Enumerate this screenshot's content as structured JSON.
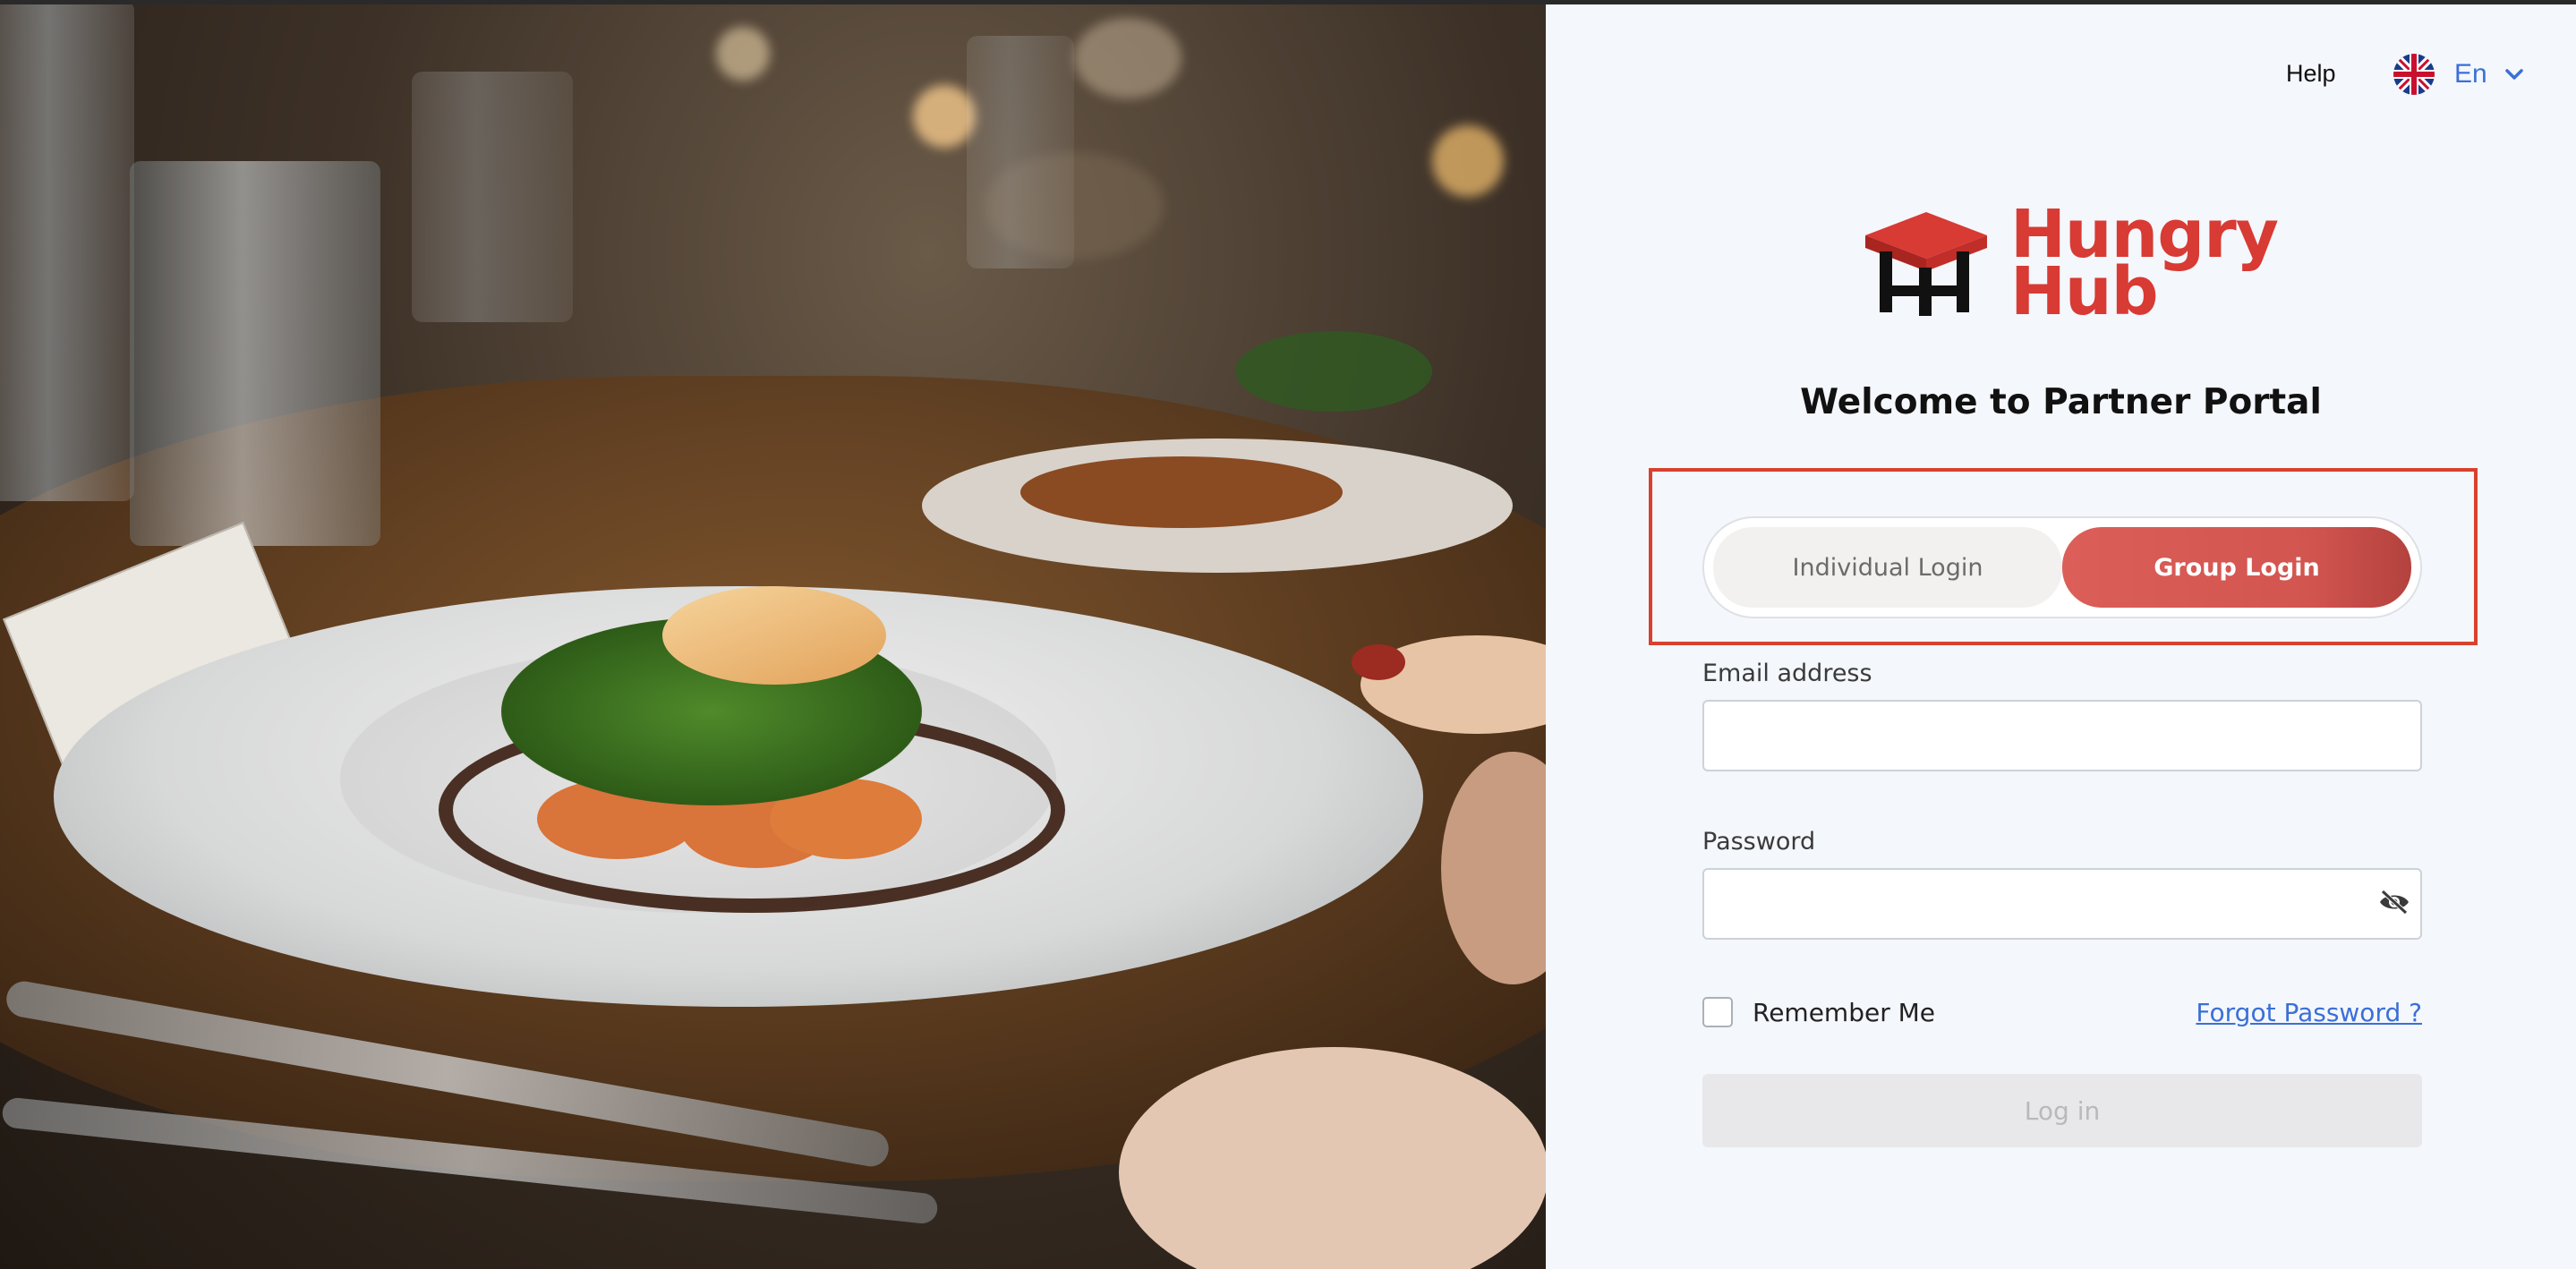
{
  "header": {
    "help_label": "Help",
    "language": {
      "code": "En",
      "flag_icon": "uk-flag-icon",
      "chevron_icon": "chevron-down-icon"
    }
  },
  "brand": {
    "logo_line1": "Hungry",
    "logo_line2": "Hub",
    "logo_icon": "table-icon",
    "color": "#d83a34"
  },
  "welcome_title": "Welcome to Partner Portal",
  "login_tabs": {
    "individual": "Individual Login",
    "group": "Group Login",
    "selected": "group"
  },
  "form": {
    "email_label": "Email address",
    "email_value": "",
    "password_label": "Password",
    "password_value": "",
    "password_toggle_icon": "eye-slash-icon",
    "remember_label": "Remember Me",
    "remember_checked": false,
    "forgot_label": "Forgot Password ?",
    "submit_label": "Log in",
    "submit_enabled": false
  },
  "colors": {
    "accent": "#d35550",
    "link": "#3b6fd8",
    "highlight_border": "#d8412e",
    "panel_bg": "#f4f7fb"
  }
}
